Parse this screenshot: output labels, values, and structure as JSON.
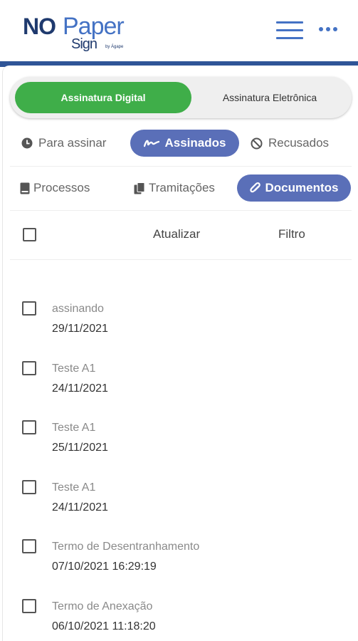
{
  "header": {
    "logo_no": "NO",
    "logo_paper": "Paper",
    "logo_sign": "Sign",
    "logo_by": "by Ágape",
    "menu_icon": "hamburger-icon",
    "more_icon": "more-dots-icon"
  },
  "segment": {
    "digital": "Assinatura Digital",
    "eletronica": "Assinatura Eletrônica"
  },
  "status_tabs": {
    "para_assinar": "Para assinar",
    "assinados": "Assinados",
    "recusados": "Recusados"
  },
  "type_tabs": {
    "processos": "Processos",
    "tramitacoes": "Tramitações",
    "documentos": "Documentos"
  },
  "toolbar": {
    "atualizar": "Atualizar",
    "filtro": "Filtro"
  },
  "items": [
    {
      "title": "assinando",
      "date": "29/11/2021"
    },
    {
      "title": "Teste A1",
      "date": "24/11/2021"
    },
    {
      "title": "Teste A1",
      "date": "25/11/2021"
    },
    {
      "title": "Teste A1",
      "date": "24/11/2021"
    },
    {
      "title": "Termo de Desentranhamento",
      "date": "07/10/2021 16:29:19"
    },
    {
      "title": "Termo de Anexação",
      "date": "06/10/2021 11:18:20"
    }
  ],
  "colors": {
    "brand_navy": "#1f3a6e",
    "brand_blue": "#4472c4",
    "active_green": "#3fae49",
    "active_pill": "#5a6fb8"
  }
}
